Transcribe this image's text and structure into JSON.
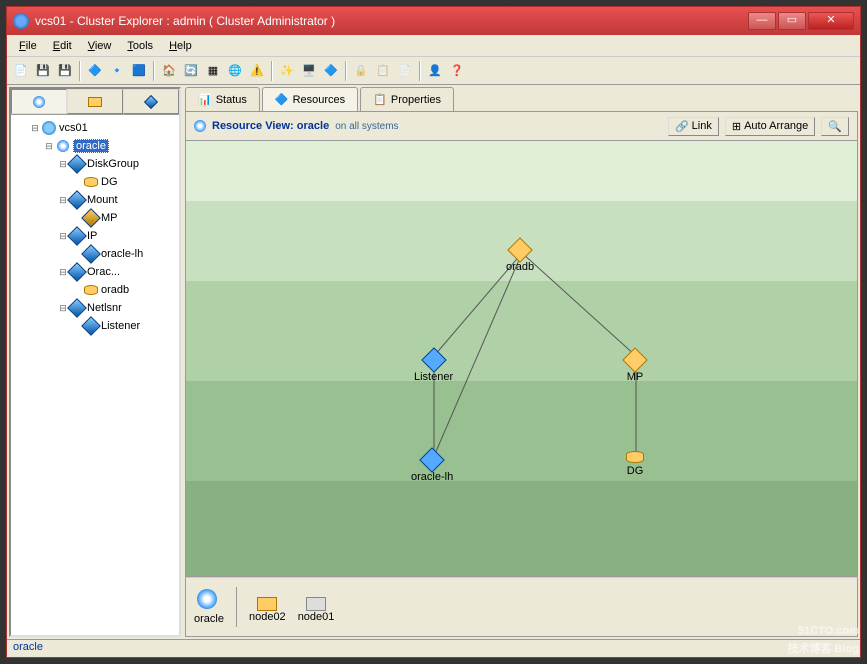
{
  "window": {
    "title": "vcs01 - Cluster Explorer : admin ( Cluster Administrator )"
  },
  "menu": {
    "file": "File",
    "edit": "Edit",
    "view": "View",
    "tools": "Tools",
    "help": "Help"
  },
  "tree": {
    "root": "vcs01",
    "group": "oracle",
    "items": [
      {
        "type": "DiskGroup",
        "res": "DG"
      },
      {
        "type": "Mount",
        "res": "MP"
      },
      {
        "type": "IP",
        "res": "oracle-lh"
      },
      {
        "type": "Orac...",
        "res": "oradb"
      },
      {
        "type": "Netlsnr",
        "res": "Listener"
      }
    ]
  },
  "tabs": {
    "status": "Status",
    "resources": "Resources",
    "properties": "Properties"
  },
  "view": {
    "title": "Resource View: oracle",
    "subtitle": "on all systems",
    "link_btn": "Link",
    "auto_btn": "Auto Arrange"
  },
  "graph": {
    "nodes": {
      "oradb": "oradb",
      "listener": "Listener",
      "mp": "MP",
      "oraclelh": "oracle-lh",
      "dg": "DG"
    }
  },
  "status_items": {
    "oracle": "oracle",
    "node02": "node02",
    "node01": "node01"
  },
  "statusbar": "oracle",
  "watermark": {
    "main": "51CTO.com",
    "sub": "技术博客  Blog"
  }
}
